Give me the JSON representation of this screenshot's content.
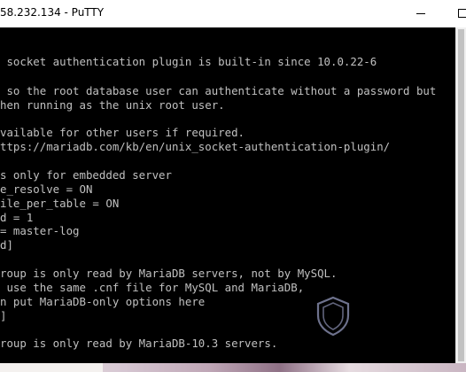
{
  "window": {
    "title": "58.232.134 - PuTTY"
  },
  "terminal": {
    "lines": [
      "",
      " socket authentication plugin is built-in since 10.0.22-6",
      "",
      " so the root database user can authenticate without a password but",
      "hen running as the unix root user.",
      "",
      "vailable for other users if required.",
      "ttps://mariadb.com/kb/en/unix_socket-authentication-plugin/",
      "",
      "s only for embedded server",
      "e_resolve = ON",
      "ile_per_table = ON",
      "d = 1",
      "= master-log",
      "d]",
      "",
      "roup is only read by MariaDB servers, not by MySQL.",
      " use the same .cnf file for MySQL and MariaDB,",
      "n put MariaDB-only options here",
      "]",
      "",
      "roup is only read by MariaDB-10.3 servers."
    ]
  },
  "colors": {
    "terminal_background": "#000000",
    "terminal_text": "#c0c0c0",
    "titlebar_background": "#ffffff"
  },
  "icons": {
    "minimize": "minimize-icon",
    "maximize": "maximize-icon",
    "watermark": "shield-icon"
  }
}
